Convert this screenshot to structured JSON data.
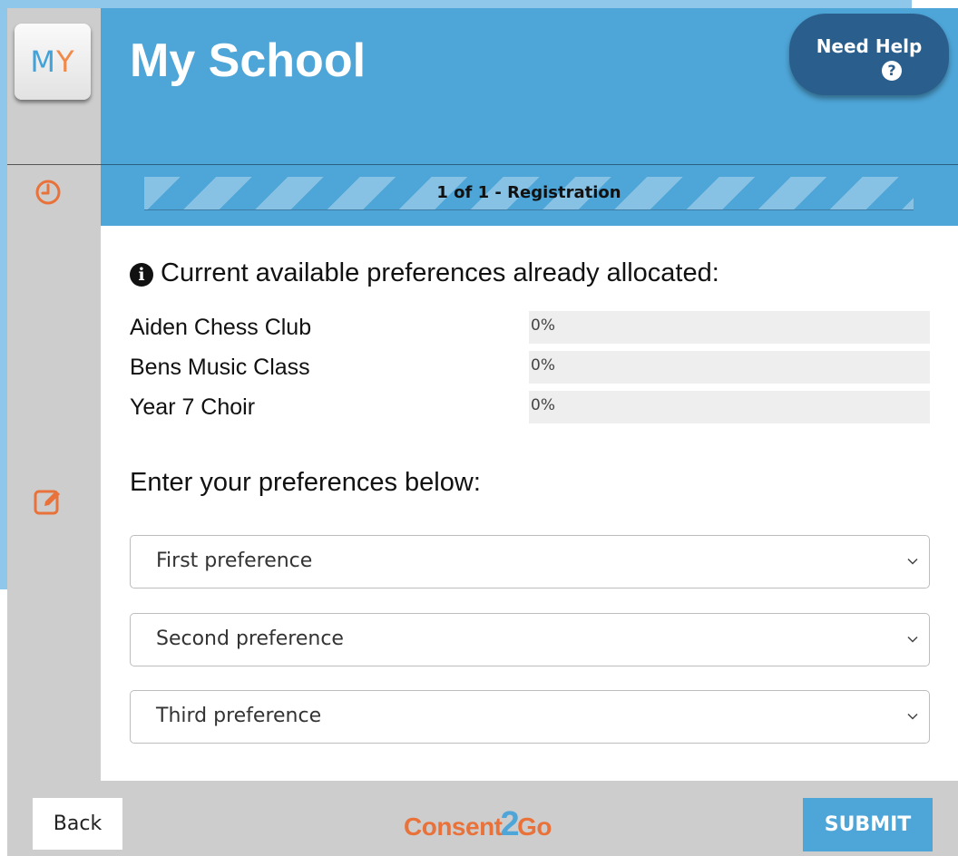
{
  "app": {
    "logo_text_left": "M",
    "logo_text_right": "Y",
    "title": "My School"
  },
  "help": {
    "label": "Need Help",
    "icon_glyph": "?"
  },
  "progress": {
    "label": "1 of 1 - Registration"
  },
  "sidebar": {
    "icons": [
      "clock-icon",
      "edit-icon"
    ]
  },
  "allocations": {
    "heading": "Current available preferences already allocated:",
    "info_glyph": "i",
    "items": [
      {
        "name": "Aiden Chess Club",
        "percent": "0%"
      },
      {
        "name": "Bens Music Class",
        "percent": "0%"
      },
      {
        "name": "Year 7 Choir",
        "percent": "0%"
      }
    ]
  },
  "preferences": {
    "heading": "Enter your preferences below:",
    "selects": [
      {
        "value": "First preference"
      },
      {
        "value": "Second preference"
      },
      {
        "value": "Third preference"
      }
    ]
  },
  "footer": {
    "back_label": "Back",
    "brand_left": "Consent",
    "brand_mid": "2",
    "brand_right": "Go",
    "submit_label": "SUBMIT"
  },
  "colors": {
    "header": "#4ea5d7",
    "sidebar": "#cdcdcd",
    "accent_orange": "#e8723a",
    "help_button": "#2a5f8d",
    "outer_border": "#8ec7ea"
  }
}
